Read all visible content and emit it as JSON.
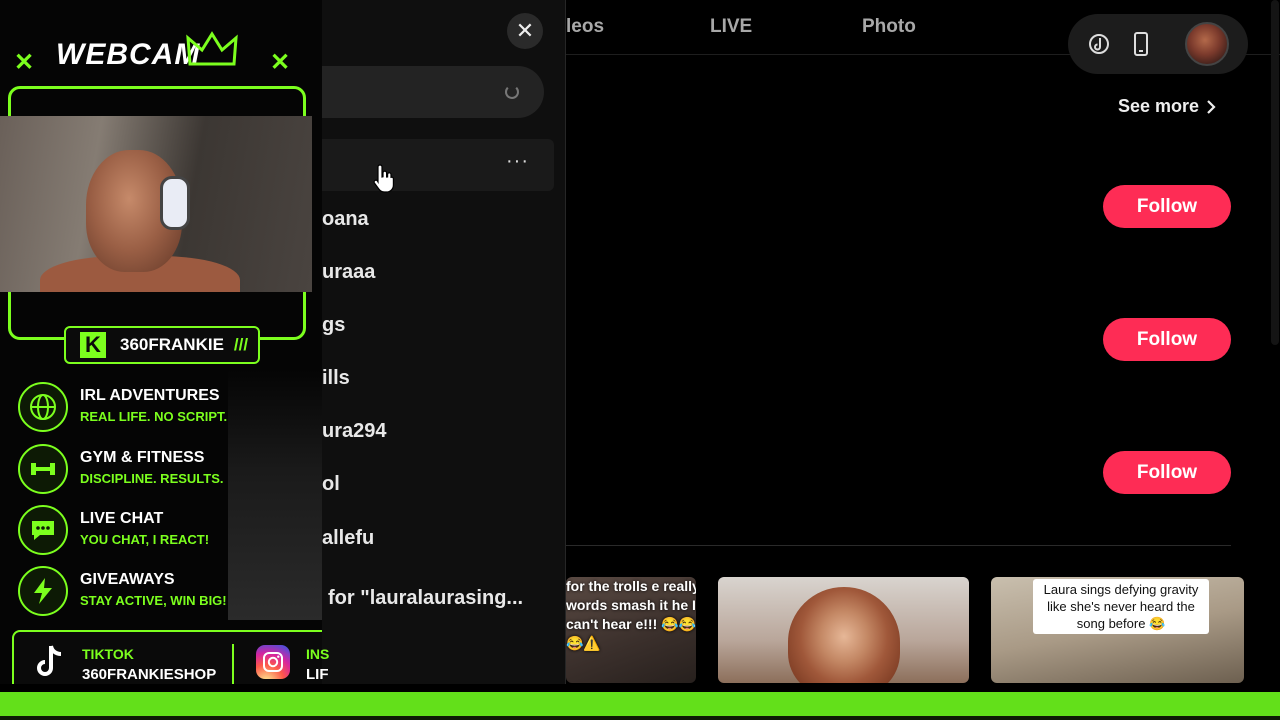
{
  "tiktok": {
    "nav_tabs": [
      "leos",
      "LIVE",
      "Photo"
    ],
    "see_more": "See more",
    "follow_label": "Follow",
    "search_placeholder": "",
    "suggestions": [
      "oana",
      "uraaa",
      "gs",
      "ills",
      "ura294",
      "ol",
      "allefu"
    ],
    "search_for": "for \"lauralaurasing...",
    "more_options": "···",
    "close_glyph": "✕",
    "thumb1_caption": "for the trolls e really words smash it he I can't hear e!!! 😂😂😂⚠️",
    "thumb3_caption": "Laura sings defying gravity like she's never heard the song before 😂",
    "accent": "#fe2c55"
  },
  "overlay": {
    "title": "WEBCAM",
    "x_mark": "✕",
    "name": "360FRANKIE",
    "slashes": "///",
    "k": "K",
    "features": [
      {
        "title": "IRL ADVENTURES",
        "sub": "REAL LIFE. NO SCRIPT.",
        "icon": "globe-icon"
      },
      {
        "title": "GYM & FITNESS",
        "sub": "DISCIPLINE. RESULTS.",
        "icon": "dumbbell-icon"
      },
      {
        "title": "LIVE CHAT",
        "sub": "YOU CHAT, I REACT!",
        "icon": "chat-icon"
      },
      {
        "title": "GIVEAWAYS",
        "sub": "STAY ACTIVE, WIN BIG!",
        "icon": "lightning-icon"
      }
    ],
    "tiktok_label": "TIKTOK",
    "tiktok_handle": "360FRANKIESHOP",
    "ig_label": "INS",
    "ig_handle": "LIF",
    "accent": "#7cff1e"
  }
}
